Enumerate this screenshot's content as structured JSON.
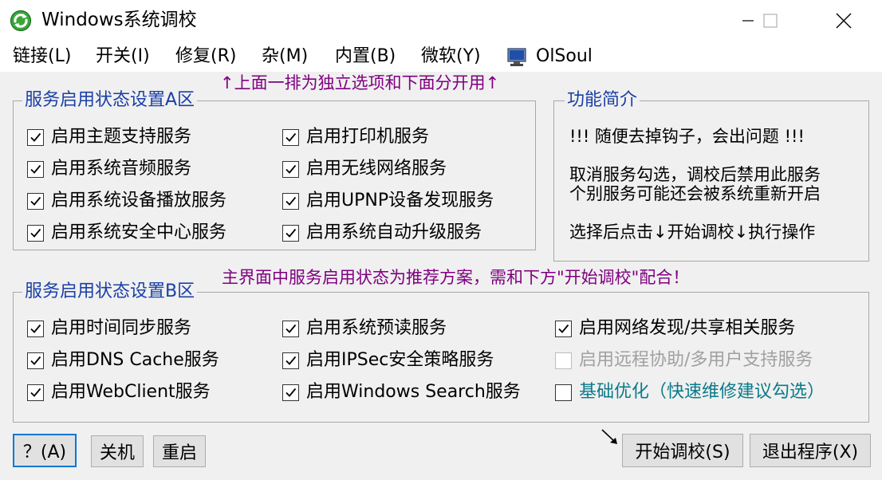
{
  "window": {
    "title": "Windows系统调校",
    "icon": "gear-arrows-icon"
  },
  "menu": [
    {
      "label": "链接(L)"
    },
    {
      "label": "开关(I)"
    },
    {
      "label": "修复(R)"
    },
    {
      "label": "杂(M)"
    },
    {
      "label": "内置(B)"
    },
    {
      "label": "微软(Y)"
    },
    {
      "label": "OlSoul",
      "icon": "computer-icon"
    }
  ],
  "hints": {
    "top": "↑上面一排为独立选项和下面分开用↑",
    "middle": "主界面中服务启用状态为推荐方案，需和下方\"开始调校\"配合！"
  },
  "group_a": {
    "title": "服务启用状态设置A区",
    "items": [
      {
        "label": "启用主题支持服务",
        "checked": true
      },
      {
        "label": "启用系统音频服务",
        "checked": true
      },
      {
        "label": "启用系统设备播放服务",
        "checked": true
      },
      {
        "label": "启用系统安全中心服务",
        "checked": true
      },
      {
        "label": "启用打印机服务",
        "checked": true
      },
      {
        "label": "启用无线网络服务",
        "checked": true
      },
      {
        "label": "启用UPNP设备发现服务",
        "checked": true
      },
      {
        "label": "启用系统自动升级服务",
        "checked": true
      }
    ]
  },
  "intro": {
    "title": "功能简介",
    "lines": [
      "!!! 随便去掉钩子，会出问题 !!!",
      "取消服务勾选，调校后禁用此服务",
      "个别服务可能还会被系统重新开启",
      "选择后点击↓开始调校↓执行操作"
    ]
  },
  "group_b": {
    "title": "服务启用状态设置B区",
    "items": [
      {
        "label": "启用时间同步服务",
        "checked": true
      },
      {
        "label": "启用DNS Cache服务",
        "checked": true
      },
      {
        "label": "启用WebClient服务",
        "checked": true
      },
      {
        "label": "启用系统预读服务",
        "checked": true
      },
      {
        "label": "启用IPSec安全策略服务",
        "checked": true
      },
      {
        "label": "启用Windows Search服务",
        "checked": true
      },
      {
        "label": "启用网络发现/共享相关服务",
        "checked": true,
        "enabled": true
      },
      {
        "label": "启用远程协助/多用户支持服务",
        "checked": false,
        "enabled": false
      },
      {
        "label": "基础优化（快速维修建议勾选）",
        "checked": false,
        "enabled": true
      }
    ]
  },
  "buttons": {
    "help": "？(A)",
    "shutdown": "关机",
    "restart": "重启",
    "start": "开始调校(S)",
    "exit": "退出程序(X)"
  },
  "colors": {
    "group_title": "#1a3fa6",
    "hint": "#800080",
    "accent_option": "#0a7a8a",
    "default_button_border": "#0078d7"
  }
}
